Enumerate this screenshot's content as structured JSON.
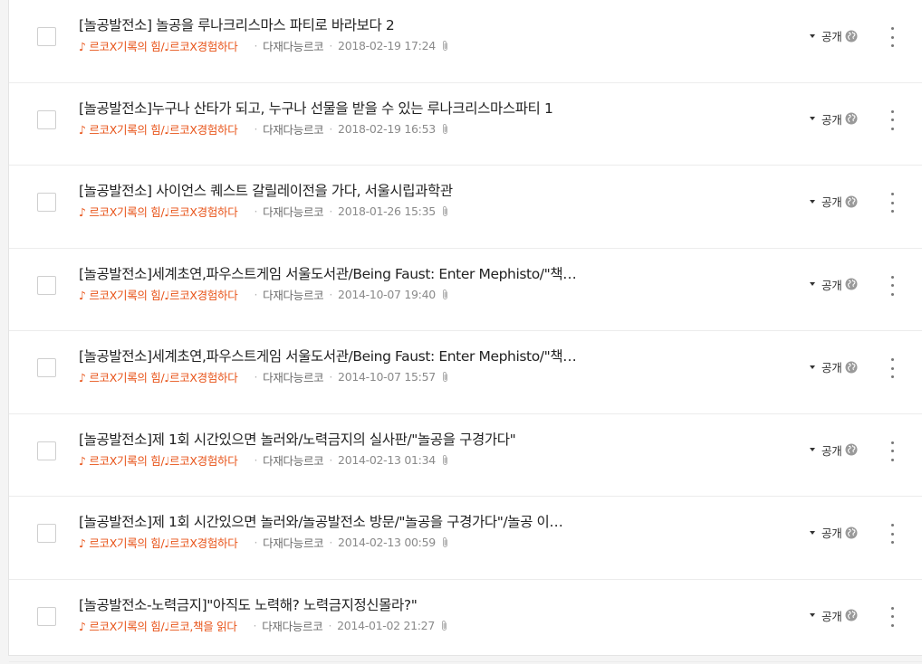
{
  "posts": [
    {
      "title": "[놀공발전소] 놀공을 루나크리스마스 파티로 바라보다 2",
      "category": "♪ 르코X기록의 힘/♩르코X경험하다",
      "author": "다재다능르코",
      "date": "2018-02-19 17:24",
      "visibility": "공개"
    },
    {
      "title": "[놀공발전소]누구나 산타가 되고, 누구나 선물을 받을 수 있는 루나크리스마스파티 1",
      "category": "♪ 르코X기록의 힘/♩르코X경험하다",
      "author": "다재다능르코",
      "date": "2018-02-19 16:53",
      "visibility": "공개"
    },
    {
      "title": "[놀공발전소] 사이언스 퀘스트 갈릴레이전을 가다, 서울시립과학관",
      "category": "♪ 르코X기록의 힘/♩르코X경험하다",
      "author": "다재다능르코",
      "date": "2018-01-26 15:35",
      "visibility": "공개"
    },
    {
      "title": "[놀공발전소]세계초연,파우스트게임 서울도서관/Being Faust: Enter Mephisto/\"책…",
      "category": "♪ 르코X기록의 힘/♩르코X경험하다",
      "author": "다재다능르코",
      "date": "2014-10-07 19:40",
      "visibility": "공개"
    },
    {
      "title": "[놀공발전소]세계초연,파우스트게임 서울도서관/Being Faust: Enter Mephisto/\"책…",
      "category": "♪ 르코X기록의 힘/♩르코X경험하다",
      "author": "다재다능르코",
      "date": "2014-10-07 15:57",
      "visibility": "공개"
    },
    {
      "title": "[놀공발전소]제 1회 시간있으면 놀러와/노력금지의 실사판/\"놀공을 구경가다\"",
      "category": "♪ 르코X기록의 힘/♩르코X경험하다",
      "author": "다재다능르코",
      "date": "2014-02-13 01:34",
      "visibility": "공개"
    },
    {
      "title": "[놀공발전소]제 1회 시간있으면 놀러와/놀공발전소 방문/\"놀공을 구경가다\"/놀공 이…",
      "category": "♪ 르코X기록의 힘/♩르코X경험하다",
      "author": "다재다능르코",
      "date": "2014-02-13 00:59",
      "visibility": "공개"
    },
    {
      "title": "[놀공발전소-노력금지]\"아직도 노력해? 노력금지정신몰라?\"",
      "category": "♪ 르코X기록의 힘/♩르코,책을 읽다",
      "author": "다재다능르코",
      "date": "2014-01-02 21:27",
      "visibility": "공개"
    }
  ],
  "icons": {
    "attachment": "paperclip-icon",
    "visibility": "globe-icon",
    "menu": "more-vertical-icon",
    "dropdown": "caret-down-icon"
  },
  "colors": {
    "category": "#e8541a",
    "title": "#222222",
    "meta": "#8a8a8a"
  }
}
